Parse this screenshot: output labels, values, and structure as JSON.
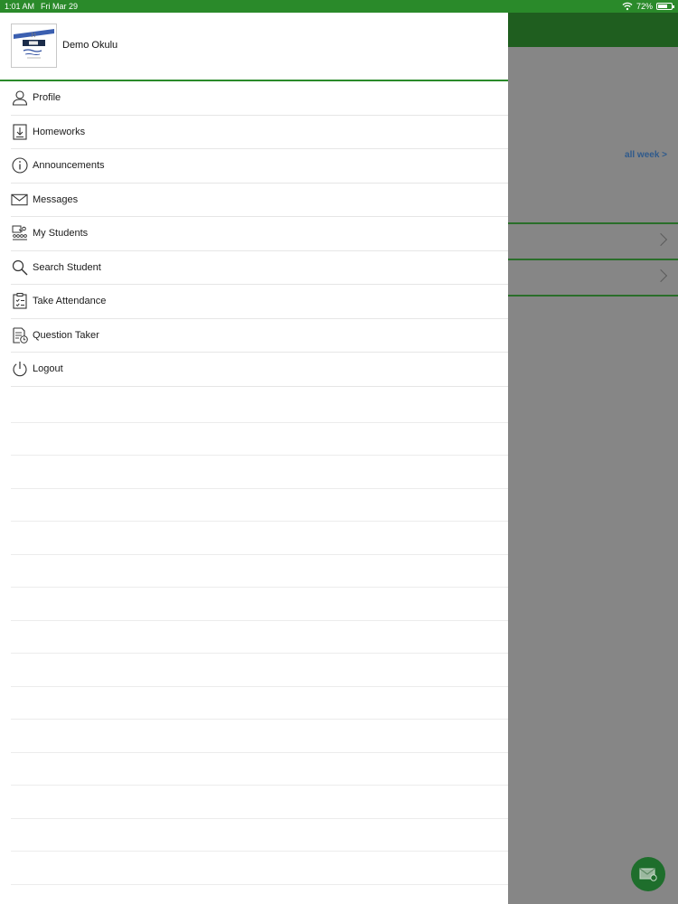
{
  "status_bar": {
    "time": "1:01 AM",
    "date": "Fri Mar 29",
    "battery_percent": "72%",
    "battery_level": 0.72
  },
  "drawer": {
    "school_name": "Demo Okulu",
    "menu": [
      {
        "label": "Profile",
        "icon": "person-icon"
      },
      {
        "label": "Homeworks",
        "icon": "download-book-icon"
      },
      {
        "label": "Announcements",
        "icon": "info-icon"
      },
      {
        "label": "Messages",
        "icon": "envelope-icon"
      },
      {
        "label": "My Students",
        "icon": "classroom-icon"
      },
      {
        "label": "Search Student",
        "icon": "search-icon"
      },
      {
        "label": "Take Attendance",
        "icon": "clipboard-icon"
      },
      {
        "label": "Question Taker",
        "icon": "document-clock-icon"
      },
      {
        "label": "Logout",
        "icon": "power-icon"
      }
    ]
  },
  "background": {
    "all_week_link": "all week >"
  },
  "colors": {
    "status_bar": "#2a8a2a",
    "header_dimmed": "#1f5e1f",
    "accent_green": "#2a8a2a",
    "link_blue": "#2f5a8c",
    "fab": "#1e6e2c"
  }
}
